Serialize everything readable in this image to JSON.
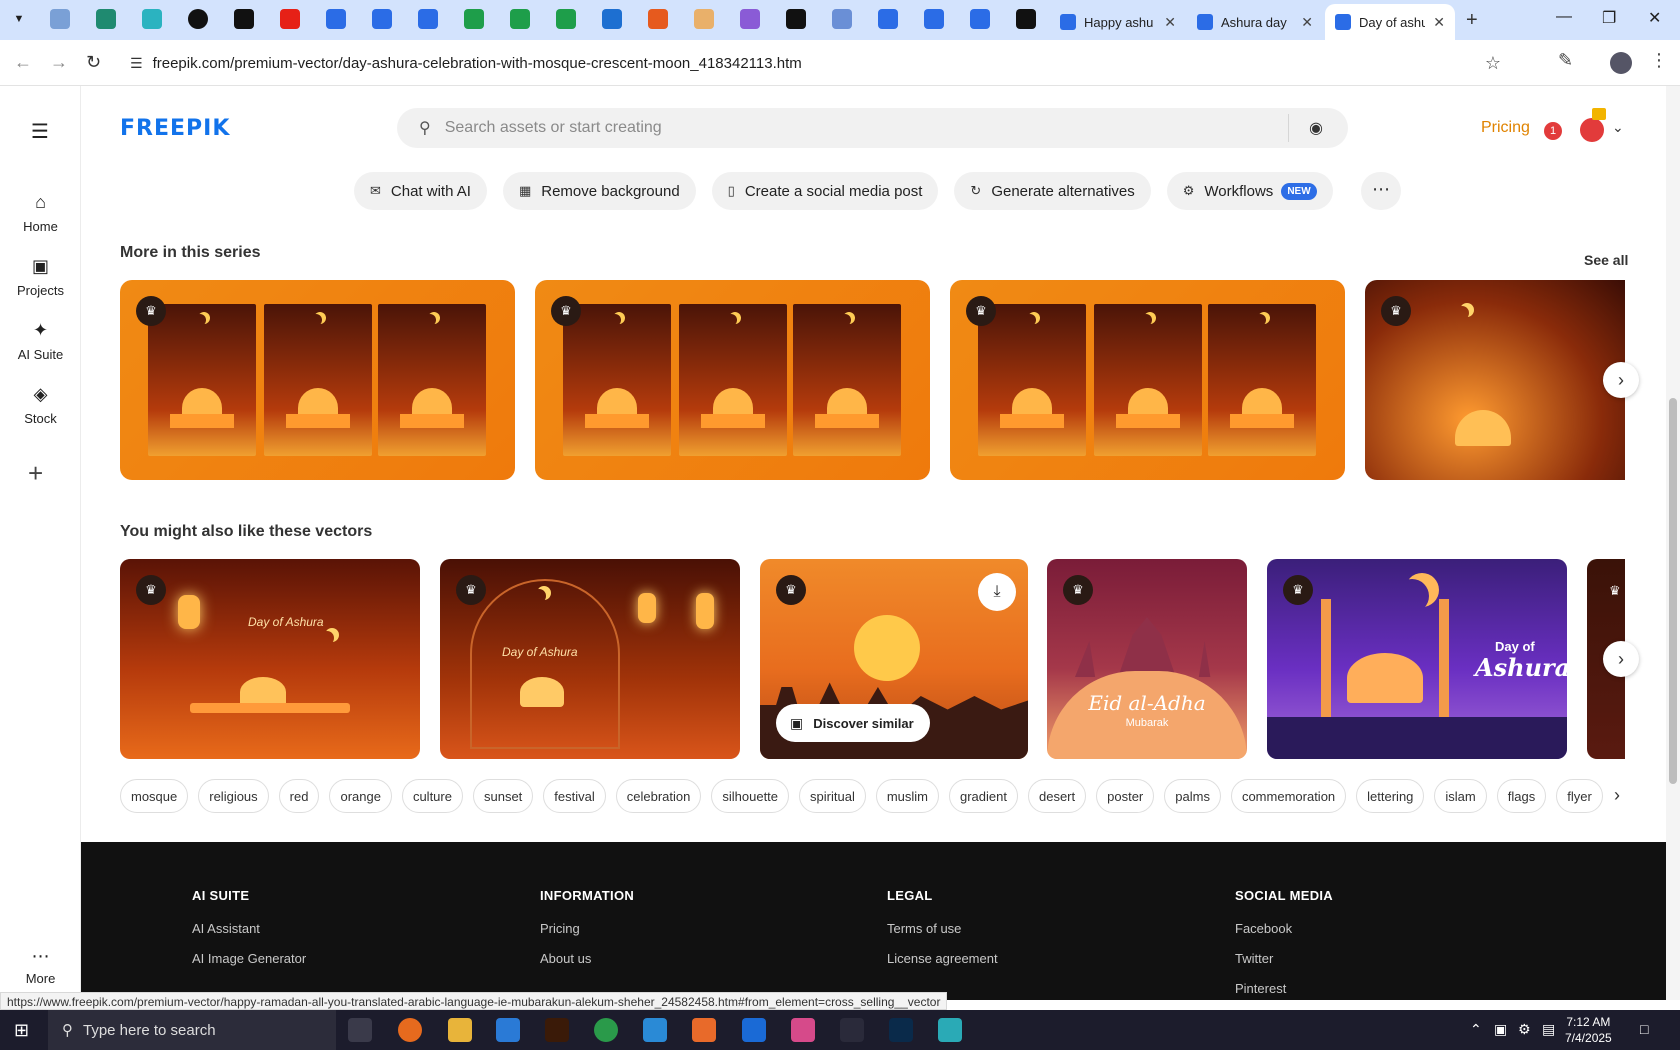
{
  "browser": {
    "tabs": [
      {
        "title": "Happy ashu",
        "active": false
      },
      {
        "title": "Ashura day",
        "active": false
      },
      {
        "title": "Day of ashu",
        "active": true
      }
    ],
    "url": "freepik.com/premium-vector/day-ashura-celebration-with-mosque-crescent-moon_418342113.htm",
    "status_url": "https://www.freepik.com/premium-vector/happy-ramadan-all-you-translated-arabic-language-ie-mubarakun-alekum-sheher_24582458.htm#from_element=cross_selling__vector"
  },
  "sidebar": {
    "items": [
      {
        "label": "Home",
        "icon": "home-icon"
      },
      {
        "label": "Projects",
        "icon": "folder-icon"
      },
      {
        "label": "AI Suite",
        "icon": "sparkle-icon"
      },
      {
        "label": "Stock",
        "icon": "stock-icon"
      }
    ],
    "more_label": "More"
  },
  "header": {
    "logo": "FREEPIK",
    "search_placeholder": "Search assets or start creating",
    "pricing_label": "Pricing",
    "notification_count": "1"
  },
  "actions": [
    {
      "label": "Chat with AI",
      "icon": "chat-icon"
    },
    {
      "label": "Remove background",
      "icon": "remove-bg-icon"
    },
    {
      "label": "Create a social media post",
      "icon": "phone-icon"
    },
    {
      "label": "Generate alternatives",
      "icon": "refresh-icon"
    },
    {
      "label": "Workflows",
      "icon": "workflow-icon",
      "badge": "NEW"
    }
  ],
  "series": {
    "title": "More in this series",
    "see_all": "See all"
  },
  "related": {
    "title": "You might also like these vectors",
    "discover_label": "Discover similar",
    "card_texts": {
      "card1_sub": "Day of Ashura",
      "card2_sub": "Day of Ashura",
      "card4_title": "Eid al-Adha",
      "card4_sub": "Mubarak",
      "card5_top": "Day of",
      "card5_title": "Ashura"
    }
  },
  "tags": [
    "mosque",
    "religious",
    "red",
    "orange",
    "culture",
    "sunset",
    "festival",
    "celebration",
    "silhouette",
    "spiritual",
    "muslim",
    "gradient",
    "desert",
    "poster",
    "palms",
    "commemoration",
    "lettering",
    "islam",
    "flags",
    "flyer"
  ],
  "footer": {
    "columns": [
      {
        "heading": "AI SUITE",
        "links": [
          "AI Assistant",
          "AI Image Generator"
        ]
      },
      {
        "heading": "INFORMATION",
        "links": [
          "Pricing",
          "About us"
        ]
      },
      {
        "heading": "LEGAL",
        "links": [
          "Terms of use",
          "License agreement"
        ]
      },
      {
        "heading": "SOCIAL MEDIA",
        "links": [
          "Facebook",
          "Twitter",
          "Pinterest"
        ]
      }
    ]
  },
  "taskbar": {
    "search_placeholder": "Type here to search",
    "time": "7:12 AM",
    "date": "7/4/2025"
  },
  "colors": {
    "brand_blue": "#1273eb",
    "pricing_orange": "#e08300",
    "footer_bg": "#111111"
  }
}
